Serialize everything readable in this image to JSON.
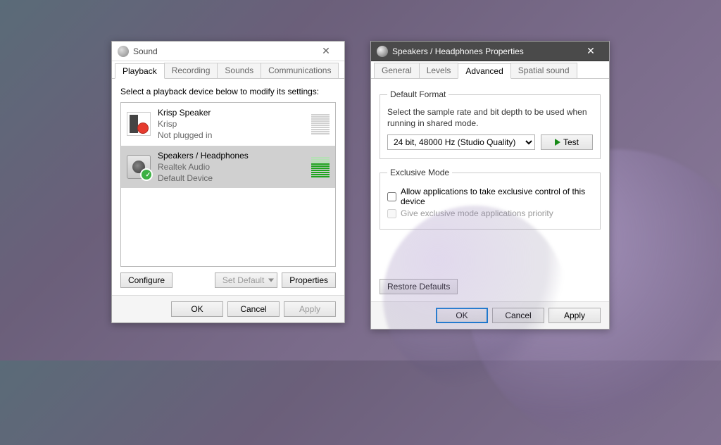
{
  "sound": {
    "title": "Sound",
    "tabs": [
      "Playback",
      "Recording",
      "Sounds",
      "Communications"
    ],
    "active_tab": 0,
    "instruction": "Select a playback device below to modify its settings:",
    "devices": [
      {
        "name": "Krisp Speaker",
        "provider": "Krisp",
        "status": "Not plugged in"
      },
      {
        "name": "Speakers / Headphones",
        "provider": "Realtek Audio",
        "status": "Default Device"
      }
    ],
    "buttons": {
      "configure": "Configure",
      "set_default": "Set Default",
      "properties": "Properties"
    },
    "footer": {
      "ok": "OK",
      "cancel": "Cancel",
      "apply": "Apply"
    }
  },
  "props": {
    "title": "Speakers / Headphones Properties",
    "tabs": [
      "General",
      "Levels",
      "Advanced",
      "Spatial sound"
    ],
    "active_tab": 2,
    "default_format": {
      "legend": "Default Format",
      "text": "Select the sample rate and bit depth to be used when running in shared mode.",
      "value": "24 bit, 48000 Hz (Studio Quality)",
      "test": "Test"
    },
    "exclusive": {
      "legend": "Exclusive Mode",
      "opt1": "Allow applications to take exclusive control of this device",
      "opt2": "Give exclusive mode applications priority"
    },
    "restore": "Restore Defaults",
    "footer": {
      "ok": "OK",
      "cancel": "Cancel",
      "apply": "Apply"
    }
  }
}
